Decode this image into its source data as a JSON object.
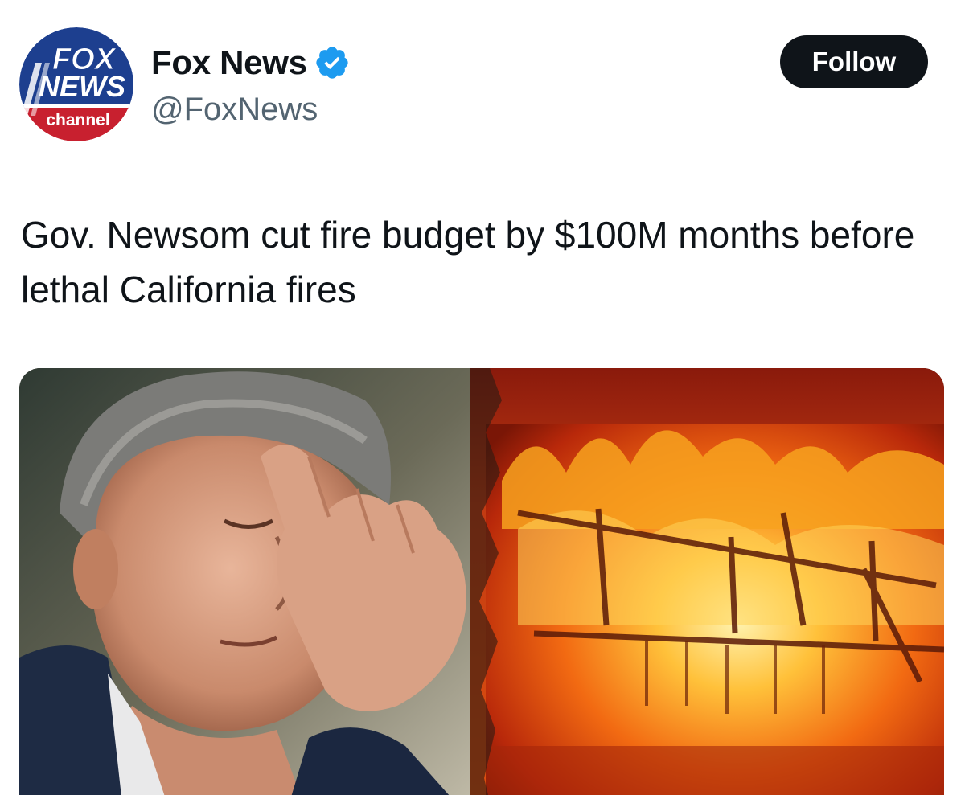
{
  "tweet": {
    "author": {
      "display_name": "Fox News",
      "handle": "@FoxNews",
      "verified": true,
      "verified_icon": "verified-badge-icon",
      "avatar_logo": {
        "line1": "FOX",
        "line2": "NEWS",
        "line3": "channel"
      }
    },
    "follow_label": "Follow",
    "text": "Gov. Newsom cut fire budget by $100M months before lethal California fires",
    "media": {
      "type": "photo"
    }
  },
  "colors": {
    "text_primary": "#0f1419",
    "text_secondary": "#536471",
    "verified_blue": "#1d9bf0",
    "follow_bg": "#0f1419",
    "follow_text": "#ffffff",
    "fox_blue": "#1d3f8f",
    "fox_red": "#c8202f"
  }
}
